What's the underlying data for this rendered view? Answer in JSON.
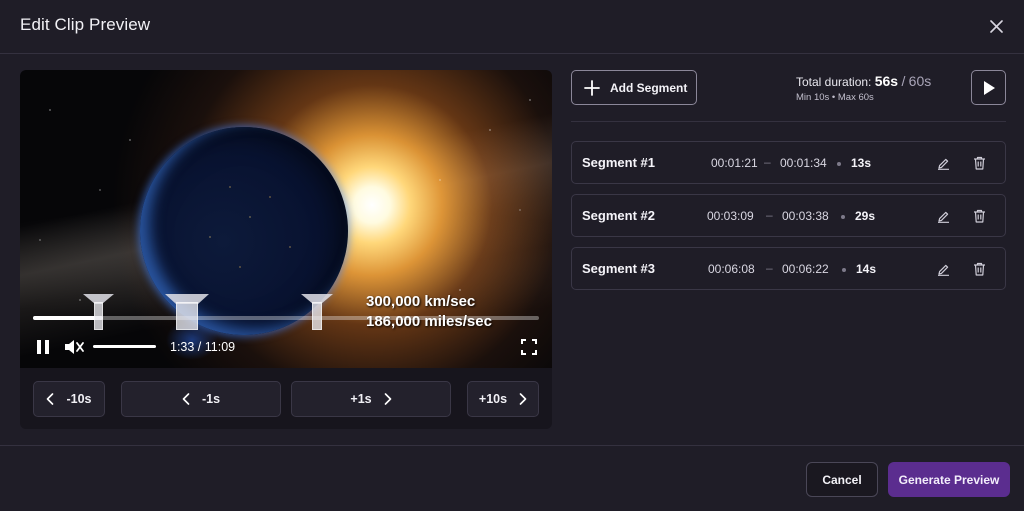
{
  "dialog": {
    "title": "Edit Clip Preview"
  },
  "icons": {
    "close": "close-icon",
    "pause": "pause-icon",
    "volume": "volume-icon",
    "fullscreen": "fullscreen-icon",
    "plus": "plus-icon",
    "play": "play-icon",
    "edit": "pencil-icon",
    "delete": "trash-icon",
    "chevron_left": "chevron-left-icon",
    "chevron_right": "chevron-right-icon"
  },
  "player": {
    "caption_line1": "300,000 km/sec",
    "caption_line2": "186,000 miles/sec",
    "time_display": "1:33 / 11:09",
    "progress_fraction": 0.139,
    "volume_fraction": 1.0
  },
  "seek_buttons": [
    {
      "label": "-10s",
      "direction": "back"
    },
    {
      "label": "-1s",
      "direction": "back"
    },
    {
      "label": "+1s",
      "direction": "forward"
    },
    {
      "label": "+10s",
      "direction": "forward"
    }
  ],
  "toolbar": {
    "add_segment_label": "Add Segment"
  },
  "duration": {
    "label": "Total duration:",
    "current": "56s",
    "separator": "/",
    "max": "60s",
    "limits": "Min 10s • Max 60s"
  },
  "segments": [
    {
      "name": "Segment #1",
      "start": "00:01:21",
      "end": "00:01:34",
      "length": "13s"
    },
    {
      "name": "Segment #2",
      "start": "00:03:09",
      "end": "00:03:38",
      "length": "29s"
    },
    {
      "name": "Segment #3",
      "start": "00:06:08",
      "end": "00:06:22",
      "length": "14s"
    }
  ],
  "segment_separator": "–",
  "footer": {
    "cancel_label": "Cancel",
    "generate_label": "Generate Preview"
  },
  "colors": {
    "background": "#1f1d27",
    "panel": "#17151d",
    "accent": "#5b2d8f",
    "border": "#3a3746"
  }
}
